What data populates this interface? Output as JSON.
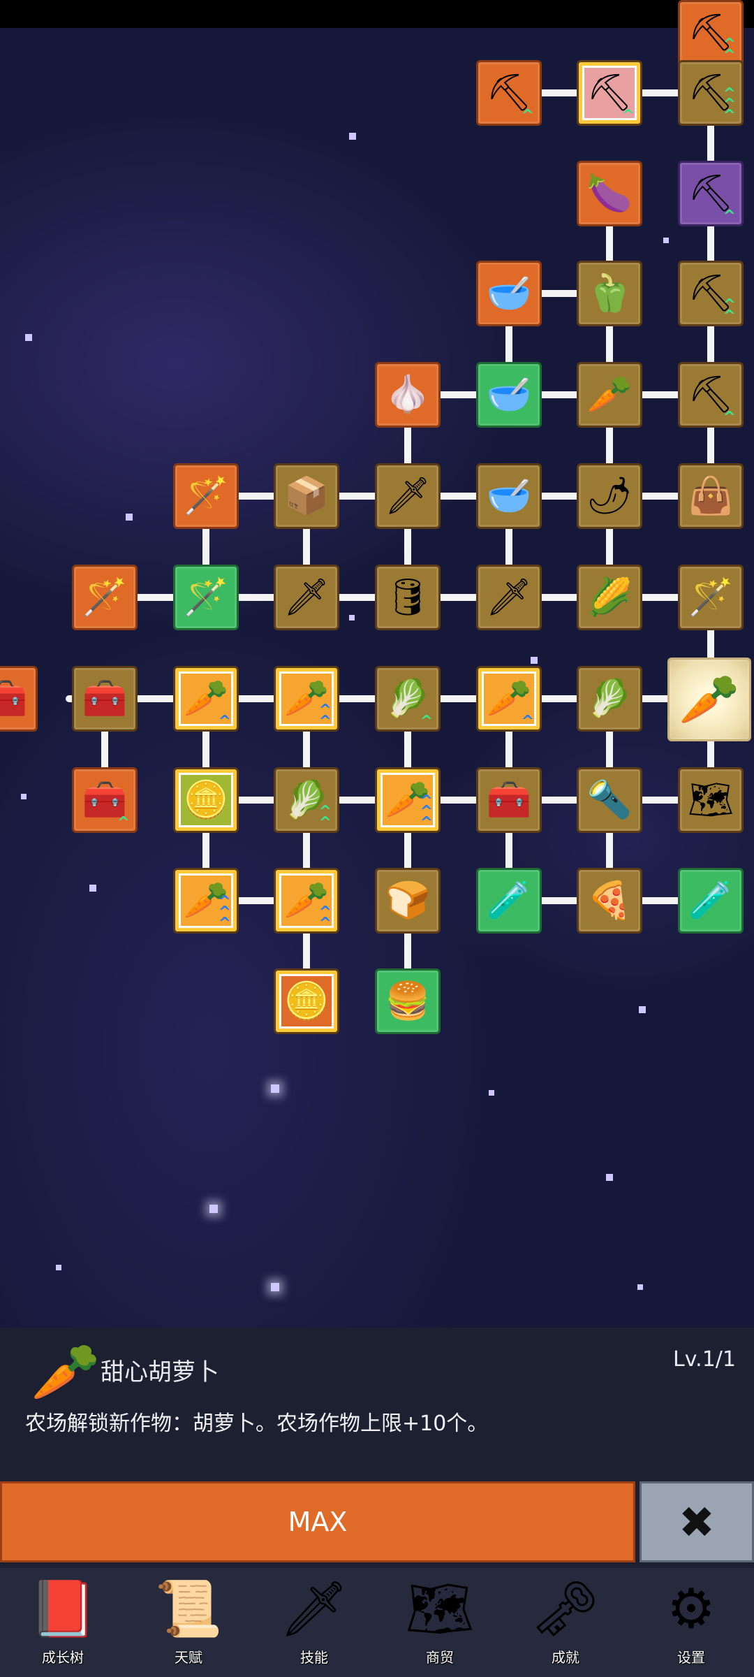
{
  "colors": {
    "locked": "#e06a28",
    "partial": "#9b7a34",
    "maxed": "#3cbb62",
    "special": "#7a4fa8",
    "panel_bg": "#1d2031",
    "max_button": "#e06a28",
    "close_button": "#9aa4b2"
  },
  "tree": {
    "nodes": [
      {
        "name": "shovel",
        "icon": "shovel-icon",
        "glyph": "⛏",
        "state": "locked",
        "col": 7,
        "row": 0,
        "upgrades": 2
      },
      {
        "name": "shovel",
        "icon": "shovel-icon",
        "glyph": "⛏",
        "state": "locked",
        "col": 5,
        "row": 1,
        "upgrades": 1
      },
      {
        "name": "shovel",
        "icon": "shovel-icon",
        "glyph": "⛏",
        "state": "special-red",
        "col": 6,
        "row": 1,
        "upgrades": 1
      },
      {
        "name": "shovel",
        "icon": "shovel-icon",
        "glyph": "⛏",
        "state": "partial",
        "col": 7,
        "row": 1,
        "upgrades": 3
      },
      {
        "name": "eggplant",
        "icon": "eggplant-icon",
        "glyph": "🍆",
        "state": "locked",
        "col": 6,
        "row": 2,
        "upgrades": 0
      },
      {
        "name": "shovel",
        "icon": "shovel-icon",
        "glyph": "⛏",
        "state": "special",
        "col": 7,
        "row": 2,
        "upgrades": 1
      },
      {
        "name": "bowl",
        "icon": "bowl-icon",
        "glyph": "🥣",
        "state": "locked",
        "col": 5,
        "row": 3,
        "upgrades": 0
      },
      {
        "name": "pepper",
        "icon": "bell-pepper-icon",
        "glyph": "🫑",
        "state": "partial",
        "col": 6,
        "row": 3,
        "upgrades": 0
      },
      {
        "name": "shovel",
        "icon": "shovel-icon",
        "glyph": "⛏",
        "state": "partial",
        "col": 7,
        "row": 3,
        "upgrades": 2
      },
      {
        "name": "garlic",
        "icon": "garlic-icon",
        "glyph": "🧄",
        "state": "locked",
        "col": 4,
        "row": 4,
        "upgrades": 0
      },
      {
        "name": "bowl",
        "icon": "bowl-icon",
        "glyph": "🥣",
        "state": "maxed",
        "col": 5,
        "row": 4,
        "upgrades": 0
      },
      {
        "name": "radish",
        "icon": "radish-icon",
        "glyph": "🥕",
        "state": "partial",
        "col": 6,
        "row": 4,
        "upgrades": 0
      },
      {
        "name": "shovel",
        "icon": "shovel-icon",
        "glyph": "⛏",
        "state": "partial",
        "col": 7,
        "row": 4,
        "upgrades": 1
      },
      {
        "name": "staff",
        "icon": "blue-staff-icon",
        "glyph": "🪄",
        "state": "locked",
        "col": 2,
        "row": 5,
        "upgrades": 0
      },
      {
        "name": "crate",
        "icon": "crate-icon",
        "glyph": "📦",
        "state": "partial",
        "col": 3,
        "row": 5,
        "upgrades": 0
      },
      {
        "name": "sword",
        "icon": "golden-sword-icon",
        "glyph": "🗡",
        "state": "partial",
        "col": 4,
        "row": 5,
        "upgrades": 0
      },
      {
        "name": "bowl",
        "icon": "bowl-icon",
        "glyph": "🥣",
        "state": "partial",
        "col": 5,
        "row": 5,
        "upgrades": 0
      },
      {
        "name": "chili",
        "icon": "chili-icon",
        "glyph": "🌶",
        "state": "partial",
        "col": 6,
        "row": 5,
        "upgrades": 0
      },
      {
        "name": "bag",
        "icon": "sack-icon",
        "glyph": "👜",
        "state": "partial",
        "col": 7,
        "row": 5,
        "upgrades": 0
      },
      {
        "name": "staff",
        "icon": "red-staff-icon",
        "glyph": "🪄",
        "state": "locked",
        "col": 1,
        "row": 6,
        "upgrades": 0
      },
      {
        "name": "staff",
        "icon": "green-staff-icon",
        "glyph": "🪄",
        "state": "maxed",
        "col": 2,
        "row": 6,
        "upgrades": 0
      },
      {
        "name": "sword",
        "icon": "sword-icon",
        "glyph": "🗡",
        "state": "partial",
        "col": 3,
        "row": 6,
        "upgrades": 0
      },
      {
        "name": "barrel",
        "icon": "barrel-icon",
        "glyph": "🛢",
        "state": "partial",
        "col": 4,
        "row": 6,
        "upgrades": 0
      },
      {
        "name": "sword",
        "icon": "sword-icon",
        "glyph": "🗡",
        "state": "partial",
        "col": 5,
        "row": 6,
        "upgrades": 0
      },
      {
        "name": "corn",
        "icon": "corn-icon",
        "glyph": "🌽",
        "state": "partial",
        "col": 6,
        "row": 6,
        "upgrades": 0
      },
      {
        "name": "wand",
        "icon": "wand-icon",
        "glyph": "🪄",
        "state": "partial",
        "col": 7,
        "row": 6,
        "upgrades": 0
      },
      {
        "name": "chest",
        "icon": "chest-icon",
        "glyph": "🧰",
        "state": "locked",
        "col": 0,
        "row": 7,
        "upgrades": 0
      },
      {
        "name": "chest",
        "icon": "chest-icon",
        "glyph": "🧰",
        "state": "partial",
        "col": 1,
        "row": 7,
        "upgrades": 0
      },
      {
        "name": "carrot",
        "icon": "carrot-icon",
        "glyph": "🥕",
        "state": "carrot",
        "col": 2,
        "row": 7,
        "upgrades": 1
      },
      {
        "name": "carrot",
        "icon": "carrot-icon",
        "glyph": "🥕",
        "state": "carrot",
        "col": 3,
        "row": 7,
        "upgrades": 2
      },
      {
        "name": "cabbage",
        "icon": "cabbage-icon",
        "glyph": "🥬",
        "state": "partial",
        "col": 4,
        "row": 7,
        "upgrades": 1
      },
      {
        "name": "carrot",
        "icon": "carrot-icon",
        "glyph": "🥕",
        "state": "carrot",
        "col": 5,
        "row": 7,
        "upgrades": 1
      },
      {
        "name": "cabbage",
        "icon": "cabbage-icon",
        "glyph": "🥬",
        "state": "partial",
        "col": 6,
        "row": 7,
        "upgrades": 0
      },
      {
        "name": "sweet-carrot",
        "icon": "carrot-icon",
        "glyph": "🥕",
        "state": "hero",
        "col": 7,
        "row": 7,
        "upgrades": 0
      },
      {
        "name": "chest",
        "icon": "chest-icon",
        "glyph": "🧰",
        "state": "locked",
        "col": 1,
        "row": 8,
        "upgrades": 1
      },
      {
        "name": "coin",
        "icon": "coin-icon",
        "glyph": "🪙",
        "state": "coin",
        "col": 2,
        "row": 8,
        "upgrades": 0
      },
      {
        "name": "cabbage",
        "icon": "cabbage-icon",
        "glyph": "🥬",
        "state": "partial",
        "col": 3,
        "row": 8,
        "upgrades": 2
      },
      {
        "name": "carrot",
        "icon": "carrot-icon",
        "glyph": "🥕",
        "state": "carrot",
        "col": 4,
        "row": 8,
        "upgrades": 3
      },
      {
        "name": "chest",
        "icon": "treasure-chest-icon",
        "glyph": "🧰",
        "state": "partial",
        "col": 5,
        "row": 8,
        "upgrades": 0
      },
      {
        "name": "torch",
        "icon": "torch-icon",
        "glyph": "🔦",
        "state": "partial",
        "col": 6,
        "row": 8,
        "upgrades": 0
      },
      {
        "name": "map",
        "icon": "map-icon",
        "glyph": "🗺",
        "state": "partial",
        "col": 7,
        "row": 8,
        "upgrades": 0
      },
      {
        "name": "carrot",
        "icon": "carrot-icon",
        "glyph": "🥕",
        "state": "carrot",
        "col": 2,
        "row": 9,
        "upgrades": 3
      },
      {
        "name": "carrot",
        "icon": "carrot-icon",
        "glyph": "🥕",
        "state": "carrot",
        "col": 3,
        "row": 9,
        "upgrades": 2
      },
      {
        "name": "bread",
        "icon": "bread-icon",
        "glyph": "🍞",
        "state": "partial",
        "col": 4,
        "row": 9,
        "upgrades": 0
      },
      {
        "name": "potion",
        "icon": "potion-icon",
        "glyph": "🧪",
        "state": "maxed",
        "col": 5,
        "row": 9,
        "upgrades": 0
      },
      {
        "name": "pizza",
        "icon": "pizza-icon",
        "glyph": "🍕",
        "state": "partial",
        "col": 6,
        "row": 9,
        "upgrades": 0
      },
      {
        "name": "potion",
        "icon": "potion-icon",
        "glyph": "🧪",
        "state": "maxed",
        "col": 7,
        "row": 9,
        "upgrades": 0
      },
      {
        "name": "coin",
        "icon": "coin-icon",
        "glyph": "🪙",
        "state": "coin-locked",
        "col": 3,
        "row": 10,
        "upgrades": 0
      },
      {
        "name": "burger",
        "icon": "burger-icon",
        "glyph": "🍔",
        "state": "maxed",
        "col": 4,
        "row": 10,
        "upgrades": 0
      }
    ],
    "links_h": [
      [
        5,
        1,
        6,
        1
      ],
      [
        6,
        1,
        7,
        1
      ],
      [
        5,
        3,
        6,
        3
      ],
      [
        4,
        4,
        5,
        4
      ],
      [
        5,
        4,
        6,
        4
      ],
      [
        6,
        4,
        7,
        4
      ],
      [
        2,
        5,
        3,
        5
      ],
      [
        3,
        5,
        4,
        5
      ],
      [
        4,
        5,
        5,
        5
      ],
      [
        5,
        5,
        6,
        5
      ],
      [
        6,
        5,
        7,
        5
      ],
      [
        1,
        6,
        2,
        6
      ],
      [
        2,
        6,
        3,
        6
      ],
      [
        3,
        6,
        4,
        6
      ],
      [
        4,
        6,
        5,
        6
      ],
      [
        5,
        6,
        6,
        6
      ],
      [
        6,
        6,
        7,
        6
      ],
      [
        0,
        7,
        1,
        7
      ],
      [
        1,
        7,
        2,
        7
      ],
      [
        2,
        7,
        3,
        7
      ],
      [
        3,
        7,
        4,
        7
      ],
      [
        4,
        7,
        5,
        7
      ],
      [
        5,
        7,
        6,
        7
      ],
      [
        6,
        7,
        7,
        7
      ],
      [
        2,
        8,
        3,
        8
      ],
      [
        3,
        8,
        4,
        8
      ],
      [
        4,
        8,
        5,
        8
      ],
      [
        5,
        8,
        6,
        8
      ],
      [
        6,
        8,
        7,
        8
      ],
      [
        2,
        9,
        3,
        9
      ],
      [
        5,
        9,
        6,
        9
      ],
      [
        6,
        9,
        7,
        9
      ]
    ],
    "links_v": [
      [
        7,
        0,
        7,
        1
      ],
      [
        7,
        1,
        7,
        2
      ],
      [
        6,
        2,
        6,
        3
      ],
      [
        7,
        2,
        7,
        3
      ],
      [
        5,
        3,
        5,
        4
      ],
      [
        6,
        3,
        6,
        4
      ],
      [
        7,
        3,
        7,
        4
      ],
      [
        2,
        5,
        2,
        6
      ],
      [
        3,
        5,
        3,
        6
      ],
      [
        4,
        4,
        4,
        5
      ],
      [
        4,
        5,
        4,
        6
      ],
      [
        5,
        5,
        5,
        6
      ],
      [
        6,
        4,
        6,
        5
      ],
      [
        6,
        5,
        6,
        6
      ],
      [
        7,
        4,
        7,
        5
      ],
      [
        7,
        6,
        7,
        7
      ],
      [
        1,
        7,
        1,
        8
      ],
      [
        2,
        7,
        2,
        8
      ],
      [
        3,
        7,
        3,
        8
      ],
      [
        4,
        7,
        4,
        8
      ],
      [
        5,
        7,
        5,
        8
      ],
      [
        6,
        7,
        6,
        8
      ],
      [
        7,
        7,
        7,
        8
      ],
      [
        2,
        8,
        2,
        9
      ],
      [
        3,
        8,
        3,
        9
      ],
      [
        4,
        8,
        4,
        9
      ],
      [
        5,
        8,
        5,
        9
      ],
      [
        6,
        8,
        6,
        9
      ],
      [
        3,
        9,
        3,
        10
      ],
      [
        4,
        9,
        4,
        10
      ]
    ]
  },
  "detail": {
    "icon": "carrot-icon",
    "title": "甜心胡萝卜",
    "level": "Lv.1/1",
    "description": "农场解锁新作物：胡萝卜。农场作物上限+10个。"
  },
  "actions": {
    "max_label": "MAX",
    "close_icon": "close-icon"
  },
  "nav": [
    {
      "label": "成长树",
      "icon": "book-icon",
      "glyph": "📕"
    },
    {
      "label": "天赋",
      "icon": "scroll-icon",
      "glyph": "📜"
    },
    {
      "label": "技能",
      "icon": "sword-icon",
      "glyph": "🗡"
    },
    {
      "label": "商贸",
      "icon": "map-icon",
      "glyph": "🗺"
    },
    {
      "label": "成就",
      "icon": "key-icon",
      "glyph": "🗝"
    },
    {
      "label": "设置",
      "icon": "gear-icon",
      "glyph": "⚙"
    }
  ]
}
